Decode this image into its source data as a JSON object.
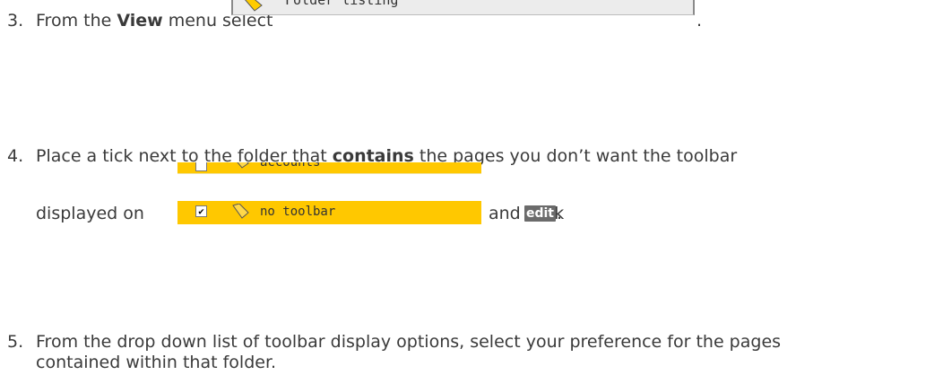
{
  "step3": {
    "number": "3.",
    "text_before": "From the ",
    "bold": "View",
    "text_after": " menu select",
    "end_punct": ".",
    "menu_item_label": "Folder listing",
    "menu_icon": "folder-icon"
  },
  "step4": {
    "number": "4.",
    "line1_before": "Place a tick next to the folder that ",
    "line1_bold": "contains",
    "line1_after": " the pages you don’t want the toolbar",
    "line2_before": "displayed on",
    "line2_after": "and click",
    "end_punct": ".",
    "folder_top_label": "accounts",
    "folder_main_label": "no toolbar",
    "checkbox_mark": "✔",
    "edit_label": "edit",
    "folder_color": "#ffc800"
  },
  "step5": {
    "number": "5.",
    "line1": "From the drop down list of toolbar display options, select your preference for the pages",
    "line2": "contained within that folder."
  }
}
